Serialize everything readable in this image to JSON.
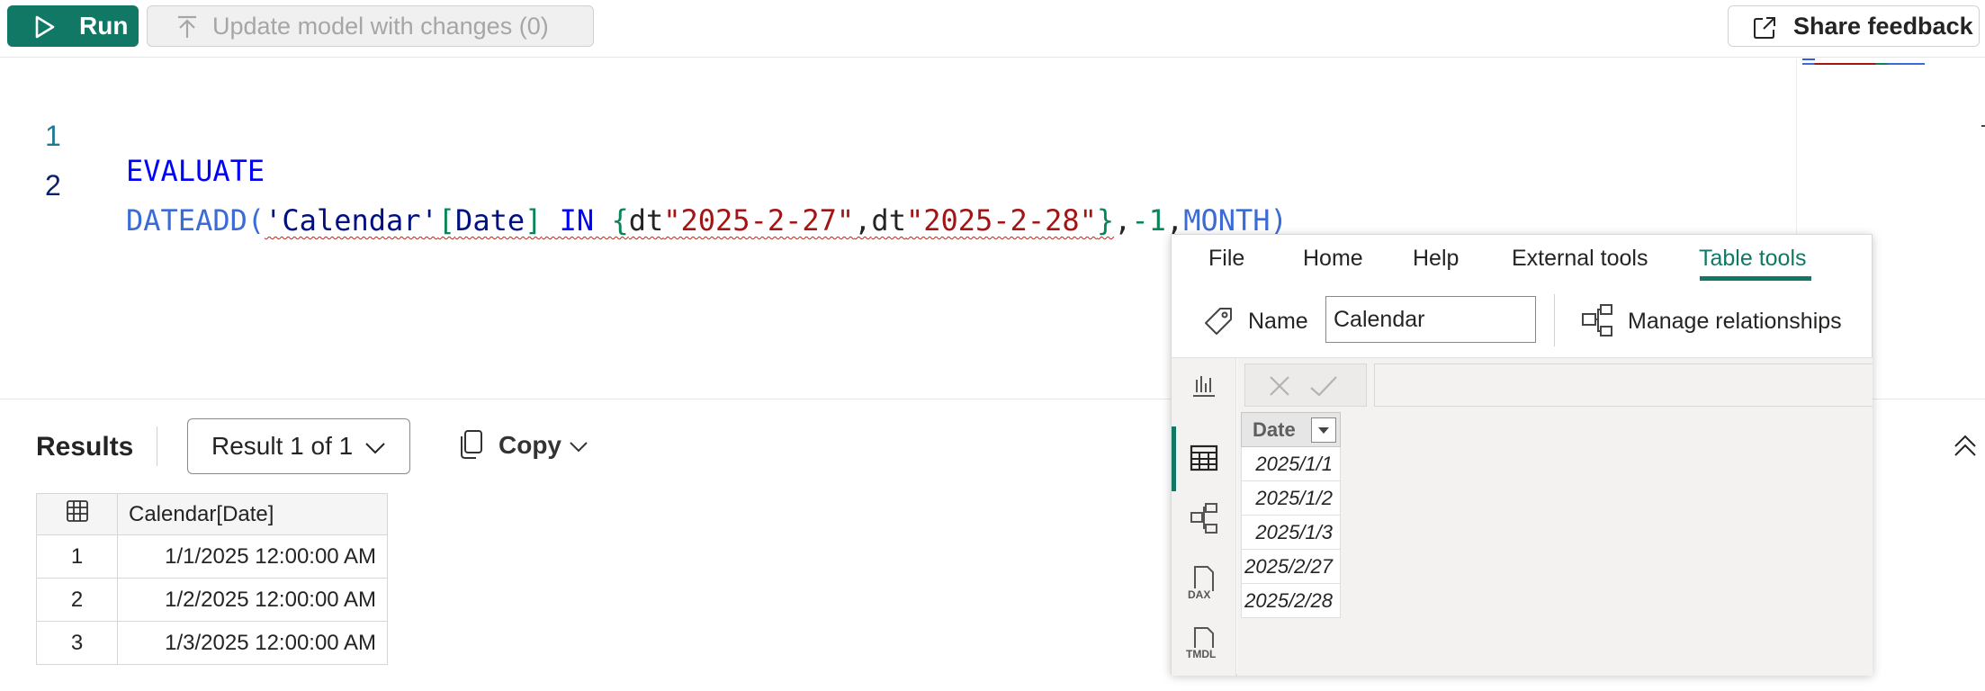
{
  "toolbar": {
    "run_label": "Run",
    "update_label": "Update model with changes (0)",
    "share_label": "Share feedback"
  },
  "editor": {
    "lines": [
      {
        "num": "1",
        "text": "EVALUATE"
      },
      {
        "num": "2",
        "tokens": {
          "fn1": "DATEADD(",
          "tbl": "'Calendar'",
          "b1": "[",
          "col": "Date",
          "b2": "]",
          "in": " IN ",
          "brace1": "{",
          "dt1": "dt",
          "s1": "\"2025-2-27\"",
          "comma1": ",",
          "dt2": "dt",
          "s2": "\"2025-2-28\"",
          "brace2": "}",
          "comma2": ",",
          "neg": "-1",
          "comma3": ",",
          "month": "MONTH",
          "close": ")"
        }
      }
    ]
  },
  "results": {
    "title": "Results",
    "selector": "Result 1 of 1",
    "copy_label": "Copy",
    "column": "Calendar[Date]",
    "rows": [
      {
        "n": "1",
        "v": "1/1/2025 12:00:00 AM"
      },
      {
        "n": "2",
        "v": "1/2/2025 12:00:00 AM"
      },
      {
        "n": "3",
        "v": "1/3/2025 12:00:00 AM"
      }
    ]
  },
  "pbi": {
    "menu": [
      "File",
      "Home",
      "Help",
      "External tools",
      "Table tools"
    ],
    "active_tab": "Table tools",
    "name_label": "Name",
    "name_value": "Calendar",
    "manage_label": "Manage relationships",
    "nav_icons": [
      "report-view-icon",
      "table-view-icon",
      "model-view-icon",
      "dax-query-view-icon",
      "tmdl-view-icon"
    ],
    "nav_dax": "DAX",
    "nav_tmdl": "TMDL",
    "table": {
      "header": "Date",
      "rows": [
        "2025/1/1",
        "2025/1/2",
        "2025/1/3",
        "2025/2/27",
        "2025/2/28"
      ]
    }
  },
  "colors": {
    "accent": "#117865",
    "keyword": "#0000ff",
    "function": "#3b6bd6",
    "string": "#a31515",
    "error_squiggle": "#e51400"
  }
}
